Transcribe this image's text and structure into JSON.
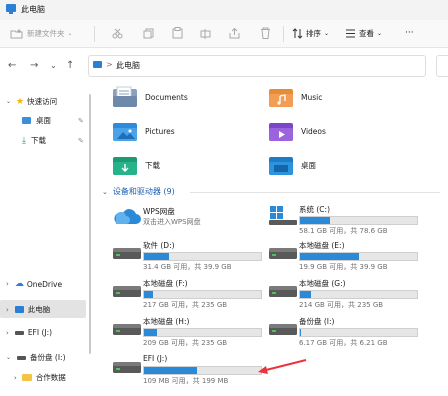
{
  "window": {
    "title": "此电脑"
  },
  "toolbar": {
    "new_folder": "新建文件夹",
    "sort": "排序",
    "view": "查看",
    "more": "···"
  },
  "address": {
    "path": "此电脑",
    "separator": ">"
  },
  "sidebar": {
    "quick_access": "快速访问",
    "desktop": "桌面",
    "downloads": "下载",
    "onedrive": "OneDrive",
    "this_pc": "此电脑",
    "efi": "EFI (J:)",
    "backup": "备份盘 (I:)",
    "work_data": "合作数据"
  },
  "folders": [
    {
      "label": "Documents",
      "icon": "documents-folder-icon"
    },
    {
      "label": "Music",
      "icon": "music-folder-icon"
    },
    {
      "label": "Pictures",
      "icon": "pictures-folder-icon"
    },
    {
      "label": "Videos",
      "icon": "videos-folder-icon"
    },
    {
      "label": "下载",
      "icon": "downloads-folder-icon"
    },
    {
      "label": "桌面",
      "icon": "desktop-folder-icon"
    }
  ],
  "section": {
    "title": "设备和驱动器 (9)"
  },
  "drives": [
    {
      "name": "WPS网盘",
      "sub": "双击进入WPS网盘",
      "cloud": true
    },
    {
      "name": "系统 (C:)",
      "free": "58.1 GB 可用，共 78.6 GB",
      "used": 0.26
    },
    {
      "name": "软件 (D:)",
      "free": "31.4 GB 可用，共 39.9 GB",
      "used": 0.21
    },
    {
      "name": "本地磁盘 (E:)",
      "free": "19.9 GB 可用，共 39.9 GB",
      "used": 0.5
    },
    {
      "name": "本地磁盘 (F:)",
      "free": "217 GB 可用，共 235 GB",
      "used": 0.08
    },
    {
      "name": "本地磁盘 (G:)",
      "free": "214 GB 可用，共 235 GB",
      "used": 0.09
    },
    {
      "name": "本地磁盘 (H:)",
      "free": "209 GB 可用，共 235 GB",
      "used": 0.11
    },
    {
      "name": "备份盘 (I:)",
      "free": "6.17 GB 可用，共 6.21 GB",
      "used": 0.01
    },
    {
      "name": "EFI (J:)",
      "free": "109 MB 可用，共 199 MB",
      "used": 0.45
    }
  ],
  "colors": {
    "accent": "#2a8ad8",
    "selection": "#e3e3e3",
    "arrow": "#e8343a"
  }
}
